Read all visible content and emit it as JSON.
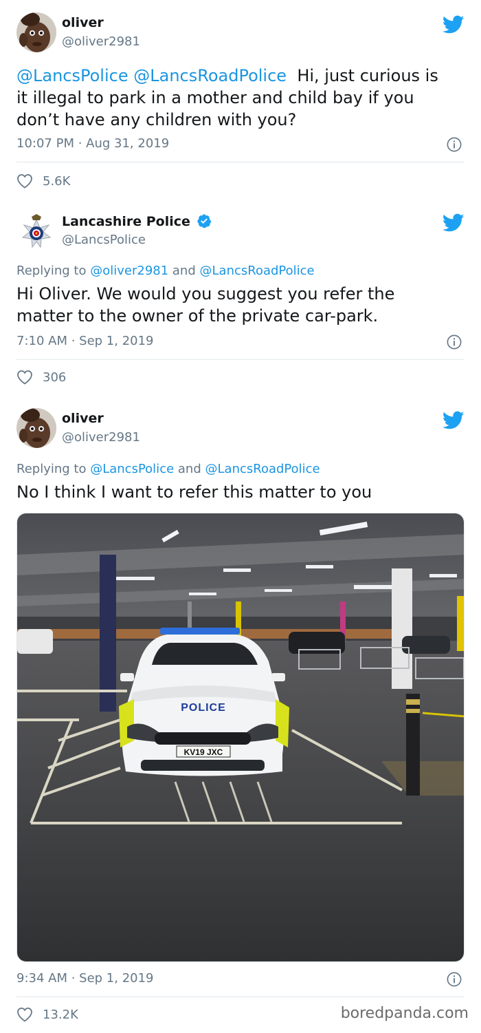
{
  "tweets": [
    {
      "name": "oliver",
      "handle": "@oliver2981",
      "mentions": [
        "@LancsPolice",
        "@LancsRoadPolice"
      ],
      "text_line1": "Hi, just curious is",
      "text_line2": "it illegal to park in a mother and child bay if you",
      "text_line3": "don’t have any children with you?",
      "timestamp": "10:07 PM · Aug 31, 2019",
      "likes": "5.6K",
      "avatar_icon": "cartoon-face-avatar"
    },
    {
      "name": "Lancashire Police",
      "handle": "@LancsPolice",
      "verified_icon": "verified-badge-icon",
      "replying_prefix": "Replying to",
      "replying_to_1": "@oliver2981",
      "replying_and": "and",
      "replying_to_2": "@LancsRoadPolice",
      "text_line1": "Hi Oliver. We would you suggest you refer the",
      "text_line2": "matter to the owner of the private car-park.",
      "timestamp": "7:10 AM · Sep 1, 2019",
      "likes": "306",
      "avatar_icon": "police-crest-avatar"
    },
    {
      "name": "oliver",
      "handle": "@oliver2981",
      "replying_prefix": "Replying to",
      "replying_to_1": "@LancsPolice",
      "replying_and": "and",
      "replying_to_2": "@LancsRoadPolice",
      "text_line1": "No I think I want to refer this matter to you",
      "timestamp": "9:34 AM · Sep 1, 2019",
      "likes": "13.2K",
      "photo": {
        "car_text": "POLICE",
        "plate": "KV19 JXC"
      },
      "avatar_icon": "cartoon-face-avatar"
    }
  ],
  "watermark": "boredpanda.com",
  "colors": {
    "link": "#1b95e0",
    "twitter_blue": "#1da1f2",
    "muted": "#657786",
    "divider": "#e1e8ed"
  }
}
